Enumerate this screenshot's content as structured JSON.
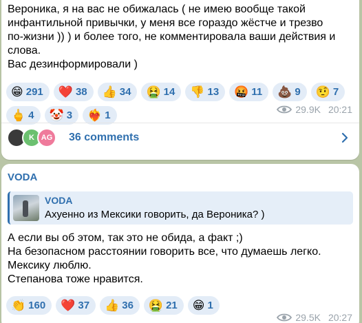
{
  "post1": {
    "text": "Вероника, я на вас не обижалась ( не имею вообще такой\nинфантильной привычки, у меня все гораздо жёстче и трезво\nпо-жизни )) ) и более того, не комментировала ваши действия и\nслова.\nВас дезинформировали )",
    "reactions": [
      {
        "emoji": "😁",
        "name": "grin-emoji",
        "count": "291"
      },
      {
        "emoji": "❤️",
        "name": "heart-emoji",
        "count": "38"
      },
      {
        "emoji": "👍",
        "name": "thumbs-up-emoji",
        "count": "34"
      },
      {
        "emoji": "🤮",
        "name": "vomit-emoji",
        "count": "14"
      },
      {
        "emoji": "👎",
        "name": "thumbs-down-emoji",
        "count": "13"
      },
      {
        "emoji": "🤬",
        "name": "swearing-emoji",
        "count": "11"
      },
      {
        "emoji": "💩",
        "name": "poop-emoji",
        "count": "9"
      },
      {
        "emoji": "🤨",
        "name": "raised-eyebrow-emoji",
        "count": "7"
      },
      {
        "emoji": "🖕",
        "name": "middle-finger-emoji",
        "count": "4"
      },
      {
        "emoji": "🤡",
        "name": "clown-emoji",
        "count": "3"
      },
      {
        "emoji": "❤️‍🔥",
        "name": "heart-on-fire-emoji",
        "count": "1"
      }
    ],
    "views": "29.9K",
    "time": "20:21",
    "comments": {
      "label": "36 comments",
      "avatar2": "K",
      "avatar3": "AG"
    }
  },
  "post2": {
    "sender": "VODA",
    "quote": {
      "name": "VODA",
      "text": "Ахуенно из Мексики говорить, да Вероника? )"
    },
    "text": "А если вы об этом, так это не обида, а факт ;)\nНа безопасном расстоянии говорить все, что думаешь легко.\nМексику люблю.\nСтепанова тоже нравится.",
    "reactions": [
      {
        "emoji": "👏",
        "name": "clap-emoji",
        "count": "160"
      },
      {
        "emoji": "❤️",
        "name": "heart-emoji",
        "count": "37"
      },
      {
        "emoji": "👍",
        "name": "thumbs-up-emoji",
        "count": "36"
      },
      {
        "emoji": "🤮",
        "name": "vomit-emoji",
        "count": "21"
      },
      {
        "emoji": "😁",
        "name": "grin-emoji",
        "count": "1"
      }
    ],
    "views": "29.5K",
    "time": "20:27"
  },
  "colors": {
    "accent": "#2f6fae",
    "background": "#b9c5a6",
    "reaction_bg": "#e3ecf7",
    "meta": "#9aa3ab"
  }
}
